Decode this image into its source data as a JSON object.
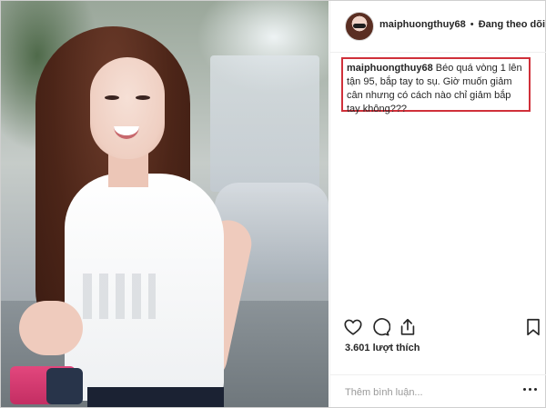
{
  "post": {
    "author": {
      "username": "maiphuongthuy68",
      "separator": "•",
      "follow_status": "Đang theo dõi"
    },
    "caption": {
      "username": "maiphuongthuy68",
      "text": "Béo quá vòng 1 lên tận 95, bắp tay to sụ. Giờ muốn giảm cân nhưng có cách nào chỉ giảm bắp tay không???"
    },
    "likes_text": "3.601 lượt thích",
    "comment": {
      "placeholder": "Thêm bình luận..."
    },
    "icons": {
      "like": "heart-icon",
      "comment": "comment-icon",
      "share": "share-icon",
      "save": "bookmark-icon",
      "more": "more-options-icon"
    },
    "colors": {
      "highlight_border": "#d0303a",
      "text": "#262626",
      "muted": "#999999"
    }
  }
}
